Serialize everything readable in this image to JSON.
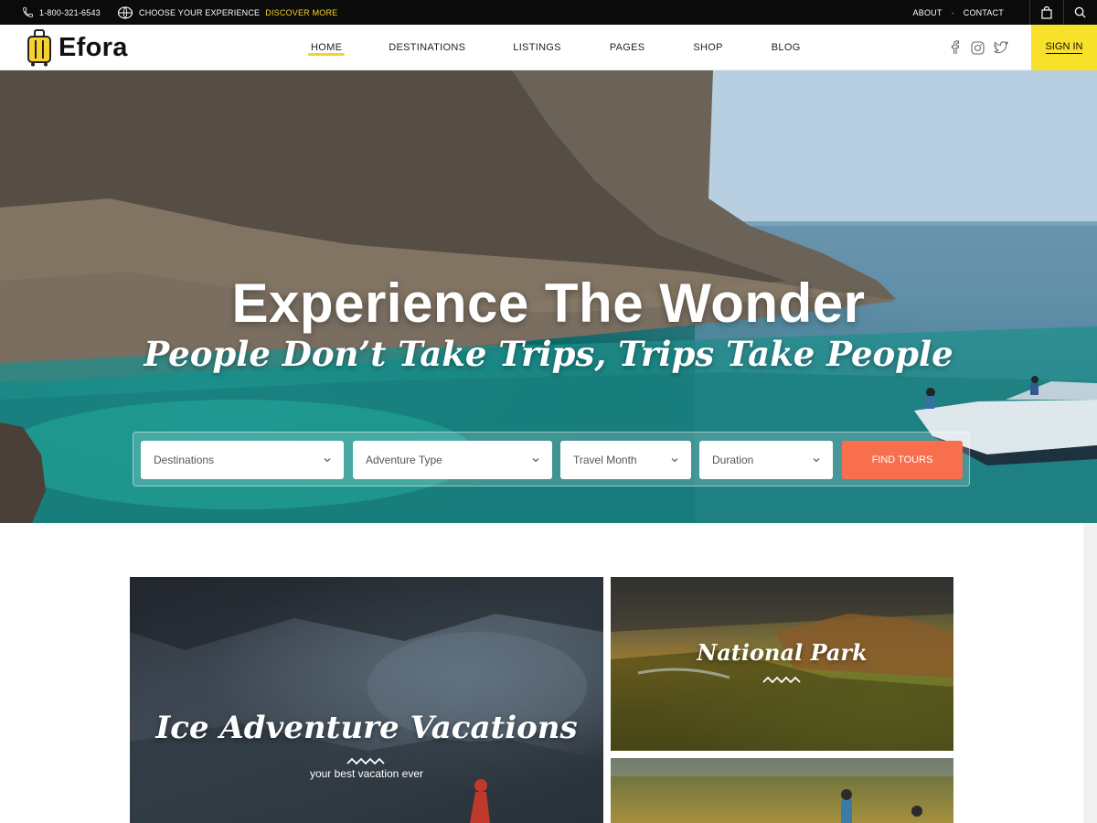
{
  "topbar": {
    "phone": "1-800-321-6543",
    "experience_prefix": "CHOOSE YOUR EXPERIENCE",
    "experience_link": "DISCOVER MORE",
    "links": [
      "ABOUT",
      "-",
      "CONTACT"
    ],
    "icons": [
      "phone-icon",
      "globe-icon",
      "shopping-bag-icon",
      "search-icon"
    ]
  },
  "navbar": {
    "logo": "Efora",
    "items": [
      {
        "label": "HOME",
        "active": true
      },
      {
        "label": "DESTINATIONS",
        "active": false
      },
      {
        "label": "LISTINGS",
        "active": false
      },
      {
        "label": "PAGES",
        "active": false
      },
      {
        "label": "SHOP",
        "active": false
      },
      {
        "label": "BLOG",
        "active": false
      }
    ],
    "social_icons": [
      "facebook-icon",
      "instagram-icon",
      "twitter-icon"
    ],
    "signin": "SIGN IN",
    "accent_color": "#f7e12a"
  },
  "hero": {
    "title": "Experience The Wonder",
    "subtitle": "People Don’t Take Trips, Trips Take People",
    "search": {
      "destinations": "Destinations",
      "adventure_type": "Adventure Type",
      "travel_month": "Travel Month",
      "duration": "Duration",
      "find_button": "FIND TOURS",
      "button_color": "#f76f4d"
    }
  },
  "cards": [
    {
      "title": "Ice Adventure Vacations",
      "caption": "your best vacation ever"
    },
    {
      "title": "National Park"
    }
  ]
}
